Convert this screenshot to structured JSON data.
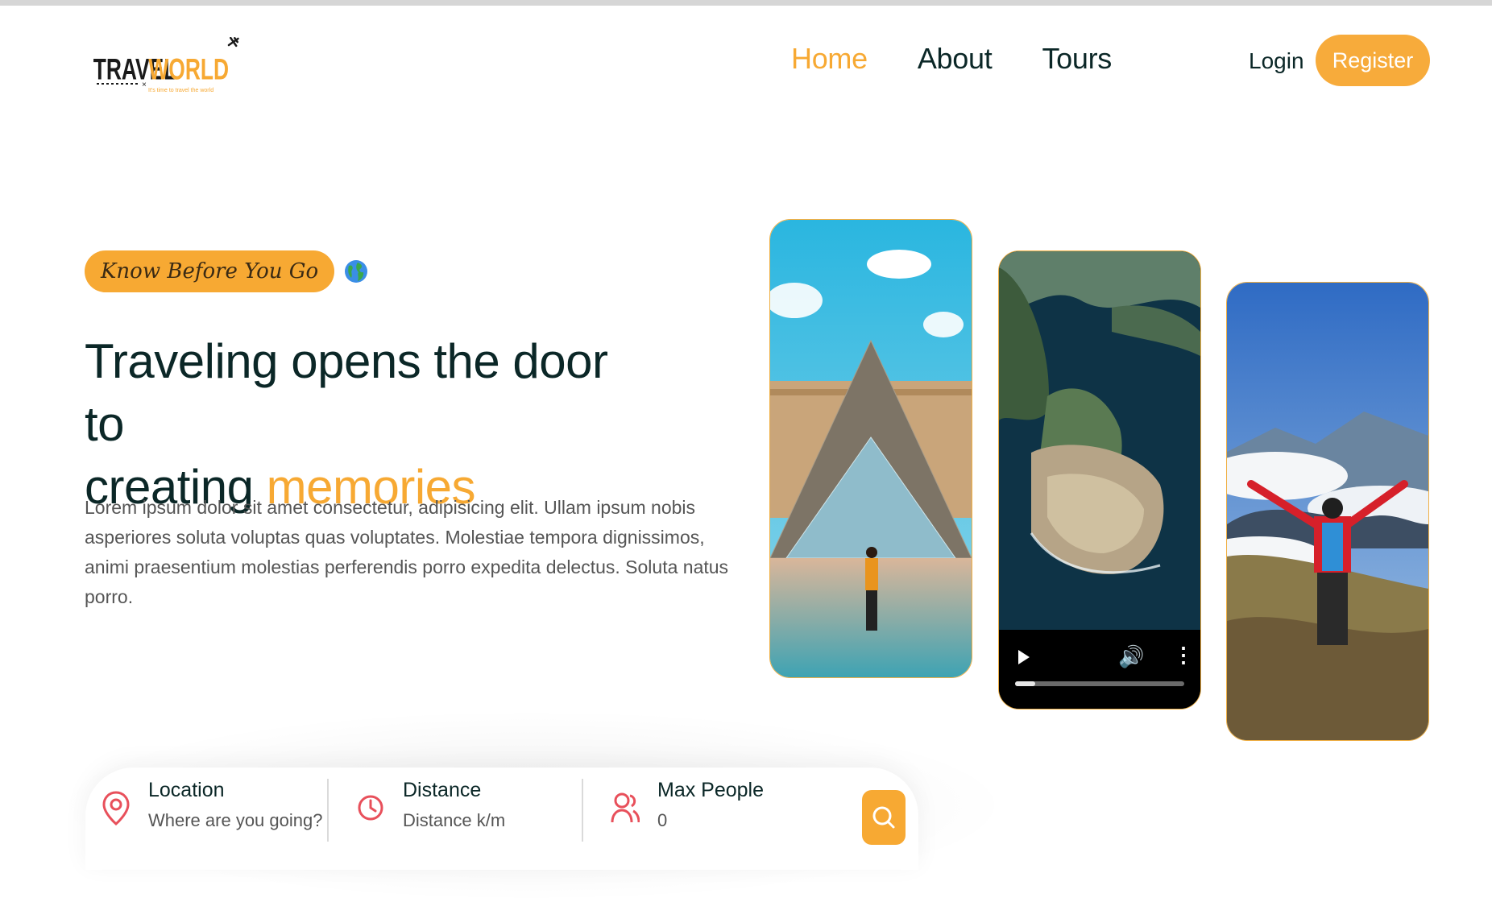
{
  "brand": {
    "name_part1": "TRAVEL",
    "name_part2": "WORLD",
    "tagline": "It's time to travel the world",
    "accent_color": "#f7a933"
  },
  "nav": {
    "items": [
      {
        "label": "Home",
        "active": true
      },
      {
        "label": "About",
        "active": false
      },
      {
        "label": "Tours",
        "active": false
      }
    ]
  },
  "auth": {
    "login_label": "Login",
    "register_label": "Register"
  },
  "hero": {
    "badge": "Know Before You Go",
    "badge_icon": "globe-icon",
    "headline_line1": "Traveling opens the door to",
    "headline_line2_prefix": "creating ",
    "headline_accent": "memories",
    "description": "Lorem ipsum dolor sit amet consectetur, adipisicing elit. Ullam ipsum nobis asperiores soluta voluptas quas voluptates. Molestiae tempora dignissimos, animi praesentium molestias perferendis porro expedita delectus. Soluta natus porro."
  },
  "media": {
    "images": [
      "louvre-pyramid-photo",
      "island-fortress-video",
      "mountain-hiker-photo"
    ],
    "video": {
      "progress_fraction": 0.12
    }
  },
  "search": {
    "fields": [
      {
        "label": "Location",
        "placeholder": "Where are you going?",
        "icon": "map-pin-icon"
      },
      {
        "label": "Distance",
        "placeholder": "Distance k/m",
        "icon": "clock-icon"
      },
      {
        "label": "Max People",
        "placeholder": "0",
        "icon": "users-icon"
      }
    ],
    "button_icon": "search-icon"
  }
}
